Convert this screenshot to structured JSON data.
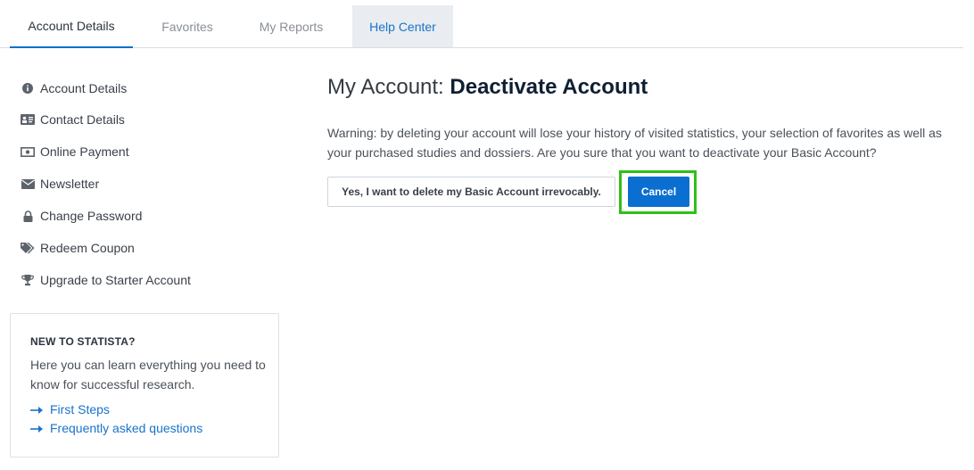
{
  "tabs": [
    {
      "label": "Account Details"
    },
    {
      "label": "Favorites"
    },
    {
      "label": "My Reports"
    },
    {
      "label": "Help Center"
    }
  ],
  "sidebar": {
    "items": [
      {
        "label": "Account Details",
        "icon": "info-circle-icon"
      },
      {
        "label": "Contact Details",
        "icon": "contact-card-icon"
      },
      {
        "label": "Online Payment",
        "icon": "money-bill-icon"
      },
      {
        "label": "Newsletter",
        "icon": "envelope-icon"
      },
      {
        "label": "Change Password",
        "icon": "lock-icon"
      },
      {
        "label": "Redeem Coupon",
        "icon": "tags-icon"
      },
      {
        "label": "Upgrade to Starter Account",
        "icon": "trophy-icon"
      }
    ],
    "promo": {
      "title": "NEW TO STATISTA?",
      "text": "Here you can learn everything you need to know for successful research.",
      "links": [
        {
          "label": "First Steps"
        },
        {
          "label": "Frequently asked questions"
        }
      ]
    }
  },
  "main": {
    "title_prefix": "My Account:",
    "title": "Deactivate Account",
    "warning": "Warning: by deleting your account will lose your history of visited statistics, your selection of favorites as well as your purchased studies and dossiers. Are you sure that you want to deactivate your Basic Account?",
    "delete_button": "Yes, I want to delete my Basic Account irrevocably.",
    "cancel_button": "Cancel"
  },
  "colors": {
    "accent": "#0a6fd0",
    "link": "#1a73c8",
    "highlight": "#2fc019"
  }
}
